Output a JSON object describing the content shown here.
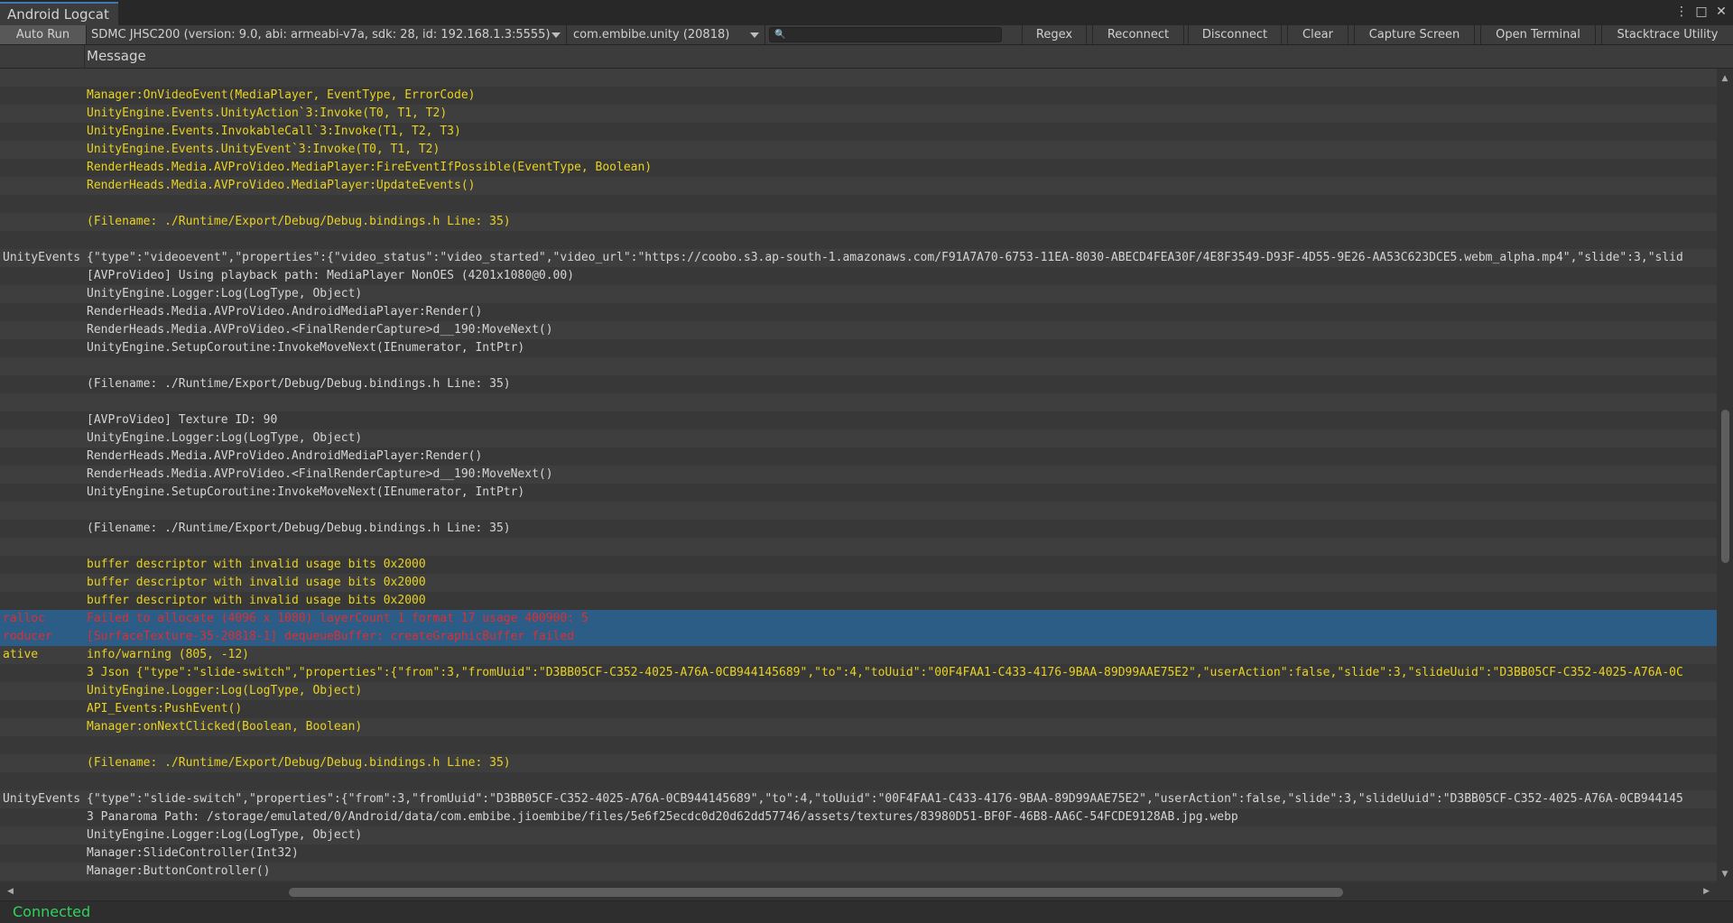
{
  "window": {
    "tab_title": "Android Logcat",
    "controls": [
      "⋮",
      "□",
      "✕"
    ]
  },
  "toolbar": {
    "auto_run": "Auto Run",
    "device": "SDMC JHSC200 (version: 9.0, abi: armeabi-v7a, sdk: 28, id: 192.168.1.3:5555)",
    "package": "com.embibe.unity (20818)",
    "search_value": "",
    "regex": "Regex",
    "reconnect": "Reconnect",
    "disconnect": "Disconnect",
    "clear": "Clear",
    "capture_screen": "Capture Screen",
    "open_terminal": "Open Terminal",
    "stacktrace_utility": "Stacktrace Utility"
  },
  "header": {
    "message_col": "Message"
  },
  "log_rows": [
    {
      "tag": "",
      "msg": "",
      "level": "warn"
    },
    {
      "tag": "",
      "msg": "Manager:OnVideoEvent(MediaPlayer, EventType, ErrorCode)",
      "level": "warn"
    },
    {
      "tag": "",
      "msg": "UnityEngine.Events.UnityAction`3:Invoke(T0, T1, T2)",
      "level": "warn"
    },
    {
      "tag": "",
      "msg": "UnityEngine.Events.InvokableCall`3:Invoke(T1, T2, T3)",
      "level": "warn"
    },
    {
      "tag": "",
      "msg": "UnityEngine.Events.UnityEvent`3:Invoke(T0, T1, T2)",
      "level": "warn"
    },
    {
      "tag": "",
      "msg": "RenderHeads.Media.AVProVideo.MediaPlayer:FireEventIfPossible(EventType, Boolean)",
      "level": "warn"
    },
    {
      "tag": "",
      "msg": "RenderHeads.Media.AVProVideo.MediaPlayer:UpdateEvents()",
      "level": "warn"
    },
    {
      "tag": "",
      "msg": "",
      "level": "warn"
    },
    {
      "tag": "",
      "msg": "(Filename: ./Runtime/Export/Debug/Debug.bindings.h Line: 35)",
      "level": "warn"
    },
    {
      "tag": "",
      "msg": "",
      "level": "warn"
    },
    {
      "tag": "UnityEvents",
      "msg": "{\"type\":\"videoevent\",\"properties\":{\"video_status\":\"video_started\",\"video_url\":\"https://coobo.s3.ap-south-1.amazonaws.com/F91A7A70-6753-11EA-8030-ABECD4FEA30F/4E8F3549-D93F-4D55-9E26-AA53C623DCE5.webm_alpha.mp4\",\"slide\":3,\"slid",
      "level": "info"
    },
    {
      "tag": "",
      "msg": "[AVProVideo] Using playback path: MediaPlayer NonOES (4201x1080@0.00)",
      "level": "info"
    },
    {
      "tag": "",
      "msg": "UnityEngine.Logger:Log(LogType, Object)",
      "level": "info"
    },
    {
      "tag": "",
      "msg": "RenderHeads.Media.AVProVideo.AndroidMediaPlayer:Render()",
      "level": "info"
    },
    {
      "tag": "",
      "msg": "RenderHeads.Media.AVProVideo.<FinalRenderCapture>d__190:MoveNext()",
      "level": "info"
    },
    {
      "tag": "",
      "msg": "UnityEngine.SetupCoroutine:InvokeMoveNext(IEnumerator, IntPtr)",
      "level": "info"
    },
    {
      "tag": "",
      "msg": "",
      "level": "info"
    },
    {
      "tag": "",
      "msg": "(Filename: ./Runtime/Export/Debug/Debug.bindings.h Line: 35)",
      "level": "info"
    },
    {
      "tag": "",
      "msg": "",
      "level": "info"
    },
    {
      "tag": "",
      "msg": "[AVProVideo] Texture ID: 90",
      "level": "info"
    },
    {
      "tag": "",
      "msg": "UnityEngine.Logger:Log(LogType, Object)",
      "level": "info"
    },
    {
      "tag": "",
      "msg": "RenderHeads.Media.AVProVideo.AndroidMediaPlayer:Render()",
      "level": "info"
    },
    {
      "tag": "",
      "msg": "RenderHeads.Media.AVProVideo.<FinalRenderCapture>d__190:MoveNext()",
      "level": "info"
    },
    {
      "tag": "",
      "msg": "UnityEngine.SetupCoroutine:InvokeMoveNext(IEnumerator, IntPtr)",
      "level": "info"
    },
    {
      "tag": "",
      "msg": "",
      "level": "info"
    },
    {
      "tag": "",
      "msg": "(Filename: ./Runtime/Export/Debug/Debug.bindings.h Line: 35)",
      "level": "info"
    },
    {
      "tag": "",
      "msg": "",
      "level": "info"
    },
    {
      "tag": "",
      "msg": "buffer descriptor with invalid usage bits 0x2000",
      "level": "warn"
    },
    {
      "tag": "",
      "msg": "buffer descriptor with invalid usage bits 0x2000",
      "level": "warn"
    },
    {
      "tag": "",
      "msg": "buffer descriptor with invalid usage bits 0x2000",
      "level": "warn"
    },
    {
      "tag": "ralloc",
      "msg": "Failed to allocate (4096 x 1080) layerCount 1 format 17 usage 400900: 5",
      "level": "error",
      "selected": true
    },
    {
      "tag": "roducer",
      "msg": "[SurfaceTexture-35-20818-1] dequeueBuffer: createGraphicBuffer failed",
      "level": "error",
      "selected": true
    },
    {
      "tag": "ative",
      "msg": "info/warning (805, -12)",
      "level": "warn"
    },
    {
      "tag": "",
      "msg": "3 Json {\"type\":\"slide-switch\",\"properties\":{\"from\":3,\"fromUuid\":\"D3BB05CF-C352-4025-A76A-0CB944145689\",\"to\":4,\"toUuid\":\"00F4FAA1-C433-4176-9BAA-89D99AAE75E2\",\"userAction\":false,\"slide\":3,\"slideUuid\":\"D3BB05CF-C352-4025-A76A-0C",
      "level": "warn"
    },
    {
      "tag": "",
      "msg": "UnityEngine.Logger:Log(LogType, Object)",
      "level": "warn"
    },
    {
      "tag": "",
      "msg": "API_Events:PushEvent()",
      "level": "warn"
    },
    {
      "tag": "",
      "msg": "Manager:onNextClicked(Boolean, Boolean)",
      "level": "warn"
    },
    {
      "tag": "",
      "msg": "",
      "level": "warn"
    },
    {
      "tag": "",
      "msg": "(Filename: ./Runtime/Export/Debug/Debug.bindings.h Line: 35)",
      "level": "warn"
    },
    {
      "tag": "",
      "msg": "",
      "level": "warn"
    },
    {
      "tag": "UnityEvents",
      "msg": "{\"type\":\"slide-switch\",\"properties\":{\"from\":3,\"fromUuid\":\"D3BB05CF-C352-4025-A76A-0CB944145689\",\"to\":4,\"toUuid\":\"00F4FAA1-C433-4176-9BAA-89D99AAE75E2\",\"userAction\":false,\"slide\":3,\"slideUuid\":\"D3BB05CF-C352-4025-A76A-0CB944145",
      "level": "info"
    },
    {
      "tag": "",
      "msg": "3 Panaroma Path: /storage/emulated/0/Android/data/com.embibe.jioembibe/files/5e6f25ecdc0d20d62dd57746/assets/textures/83980D51-BF0F-46B8-AA6C-54FCDE9128AB.jpg.webp",
      "level": "info"
    },
    {
      "tag": "",
      "msg": "UnityEngine.Logger:Log(LogType, Object)",
      "level": "info"
    },
    {
      "tag": "",
      "msg": "Manager:SlideController(Int32)",
      "level": "info"
    },
    {
      "tag": "",
      "msg": "Manager:ButtonController()",
      "level": "info"
    }
  ],
  "colors": {
    "info": "#d4d4d4",
    "warn": "#e9d21e",
    "error": "#e02e2e",
    "selection": "#2c5d87",
    "connected": "#2fd35c"
  },
  "status": {
    "text": "Connected"
  }
}
